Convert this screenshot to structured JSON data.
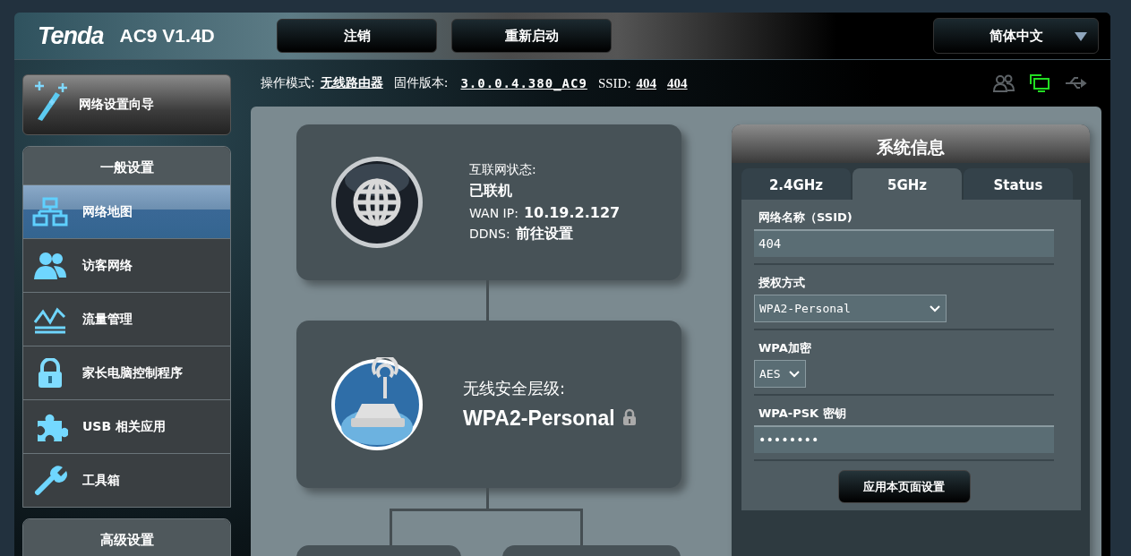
{
  "header": {
    "brand": "Tenda",
    "model": "AC9 V1.4D",
    "buttons": [
      "注销",
      "重新启动"
    ],
    "language": "简体中文"
  },
  "info": {
    "mode_label": "操作模式:",
    "mode": "无线路由器",
    "firmware_label": "固件版本:",
    "firmware": "3.0.0.4.380_AC9",
    "ssid_label": "SSID:",
    "ssids": [
      "404",
      "404"
    ]
  },
  "status_icons": [
    {
      "kind": "clients",
      "on": false
    },
    {
      "kind": "network",
      "on": true
    },
    {
      "kind": "usb",
      "on": false
    }
  ],
  "wizard": {
    "label": "网络设置向导"
  },
  "sidebar": {
    "title": "一般设置",
    "items": [
      {
        "kind": "map",
        "label": "网络地图",
        "selected": true
      },
      {
        "kind": "guest",
        "label": "访客网络",
        "selected": false
      },
      {
        "kind": "traffic",
        "label": "流量管理",
        "selected": false
      },
      {
        "kind": "parental",
        "label": "家长电脑控制程序",
        "selected": false
      },
      {
        "kind": "usb",
        "label": "USB 相关应用",
        "selected": false
      },
      {
        "kind": "tools",
        "label": "工具箱",
        "selected": false
      }
    ],
    "advanced_title": "高级设置"
  },
  "internet_card": {
    "status_label": "互联网状态:",
    "status": "已联机",
    "wan_label": "WAN IP:",
    "wan_ip": "10.19.2.127",
    "ddns_label": "DDNS:",
    "ddns_link": "前往设置"
  },
  "wireless_card": {
    "label": "无线安全层级:",
    "value": "WPA2-Personal",
    "locked": true
  },
  "system_info": {
    "title": "系统信息",
    "tabs": [
      {
        "label": "2.4GHz",
        "selected": false
      },
      {
        "label": "5GHz",
        "selected": true
      },
      {
        "label": "Status",
        "selected": false
      }
    ],
    "fields": [
      {
        "kind": "text",
        "label": "网络名称（SSID)",
        "value": "404"
      },
      {
        "kind": "select",
        "label": "授权方式",
        "value": "WPA2-Personal"
      },
      {
        "kind": "select-small",
        "label": "WPA加密",
        "value": "AES"
      },
      {
        "kind": "text",
        "label": "WPA-PSK 密钥",
        "value": "••••••••"
      }
    ],
    "apply_button": "应用本页面设置"
  }
}
